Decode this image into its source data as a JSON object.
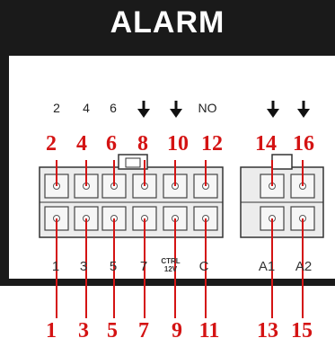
{
  "title": "ALARM",
  "top_labels": [
    "2",
    "4",
    "6",
    "NO"
  ],
  "bottom_labels": [
    "1",
    "3",
    "5",
    "7",
    "C",
    "A1",
    "A2"
  ],
  "ctrl_label": [
    "CTRL",
    "12V"
  ],
  "red_top": [
    "2",
    "4",
    "6",
    "8",
    "10",
    "12",
    "14",
    "16"
  ],
  "red_bottom": [
    "1",
    "3",
    "5",
    "7",
    "9",
    "11",
    "13",
    "15"
  ],
  "icons": {
    "ground": "ground-arrow-icon"
  },
  "colors": {
    "panel": "#1a1a1a",
    "red": "#d41313",
    "connector": "#e8e8e8",
    "line": "#d41313"
  }
}
